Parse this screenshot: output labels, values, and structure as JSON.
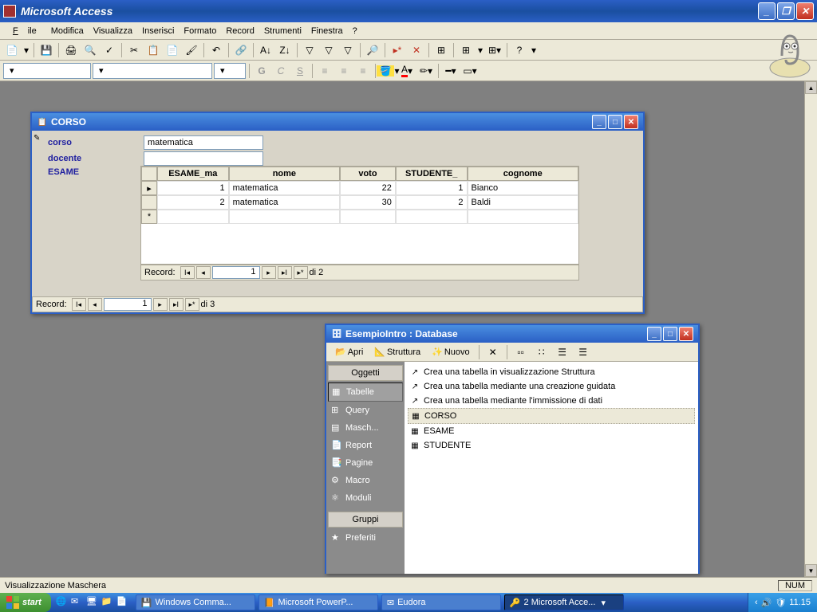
{
  "app": {
    "title": "Microsoft Access"
  },
  "menus": [
    "File",
    "Modifica",
    "Visualizza",
    "Inserisci",
    "Formato",
    "Record",
    "Strumenti",
    "Finestra",
    "?"
  ],
  "corso_window": {
    "title": "CORSO",
    "fields": {
      "corso_label": "corso",
      "corso_value": "matematica",
      "docente_label": "docente",
      "docente_value": "",
      "esame_label": "ESAME"
    },
    "sub_headers": [
      "ESAME_ma",
      "nome",
      "voto",
      "STUDENTE_",
      "cognome"
    ],
    "sub_rows": [
      {
        "id": "1",
        "nome": "matematica",
        "voto": "22",
        "studente": "1",
        "cognome": "Bianco"
      },
      {
        "id": "2",
        "nome": "matematica",
        "voto": "30",
        "studente": "2",
        "cognome": "Baldi"
      }
    ],
    "sub_nav": {
      "label": "Record:",
      "current": "1",
      "total": "di 2"
    },
    "main_nav": {
      "label": "Record:",
      "current": "1",
      "total": "di 3"
    }
  },
  "db_window": {
    "title": "EsempioIntro : Database",
    "toolbar": {
      "apri": "Apri",
      "struttura": "Struttura",
      "nuovo": "Nuovo"
    },
    "nav_header": "Oggetti",
    "nav_items": [
      "Tabelle",
      "Query",
      "Masch...",
      "Report",
      "Pagine",
      "Macro",
      "Moduli"
    ],
    "nav_footer": "Gruppi",
    "nav_pref": "Preferiti",
    "list_items": [
      "Crea una tabella in visualizzazione Struttura",
      "Crea una tabella mediante una creazione guidata",
      "Crea una tabella mediante l'immissione di dati",
      "CORSO",
      "ESAME",
      "STUDENTE"
    ]
  },
  "status": {
    "text": "Visualizzazione Maschera",
    "num": "NUM"
  },
  "taskbar": {
    "start": "start",
    "items": [
      {
        "label": "Windows Comma..."
      },
      {
        "label": "Microsoft PowerP..."
      },
      {
        "label": "Eudora"
      },
      {
        "label": "2 Microsoft Acce...",
        "active": true
      }
    ],
    "clock": "11.15"
  }
}
